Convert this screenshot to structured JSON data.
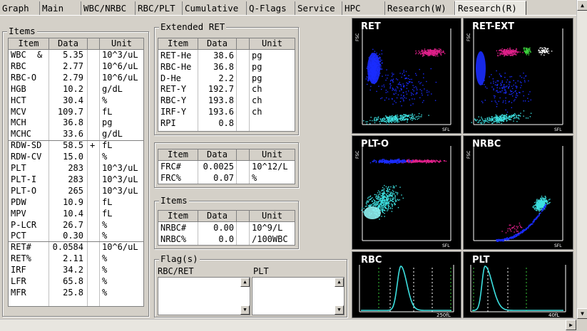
{
  "tabs": [
    "Graph",
    "Main",
    "WBC/NRBC",
    "RBC/PLT",
    "Cumulative",
    "Q-Flags",
    "Service",
    "HPC",
    "Research(W)",
    "Research(R)"
  ],
  "active_tab": "Research(R)",
  "items": {
    "title": "Items",
    "headers": [
      "Item",
      "Data",
      "Unit"
    ],
    "rows": [
      [
        "WBC",
        "&",
        "5.35",
        "",
        "10^3/uL"
      ],
      [
        "RBC",
        "",
        "2.77",
        "",
        "10^6/uL"
      ],
      [
        "RBC-O",
        "",
        "2.79",
        "",
        "10^6/uL"
      ],
      [
        "HGB",
        "",
        "10.2",
        "",
        "g/dL"
      ],
      [
        "HCT",
        "",
        "30.4",
        "",
        "%"
      ],
      [
        "MCV",
        "",
        "109.7",
        "",
        "fL"
      ],
      [
        "MCH",
        "",
        "36.8",
        "",
        "pg"
      ],
      [
        "MCHC",
        "",
        "33.6",
        "",
        "g/dL"
      ],
      [
        "RDW-SD",
        "",
        "58.5",
        "+",
        "fL"
      ],
      [
        "RDW-CV",
        "",
        "15.0",
        "",
        "%"
      ],
      [
        "PLT",
        "",
        "283",
        "",
        "10^3/uL"
      ],
      [
        "PLT-I",
        "",
        "283",
        "",
        "10^3/uL"
      ],
      [
        "PLT-O",
        "",
        "265",
        "",
        "10^3/uL"
      ],
      [
        "PDW",
        "",
        "10.9",
        "",
        "fL"
      ],
      [
        "MPV",
        "",
        "10.4",
        "",
        "fL"
      ],
      [
        "P-LCR",
        "",
        "26.7",
        "",
        "%"
      ],
      [
        "PCT",
        "",
        "0.30",
        "",
        "%"
      ],
      [
        "RET#",
        "",
        "0.0584",
        "",
        "10^6/uL"
      ],
      [
        "RET%",
        "",
        "2.11",
        "",
        "%"
      ],
      [
        "IRF",
        "",
        "34.2",
        "",
        "%"
      ],
      [
        "LFR",
        "",
        "65.8",
        "",
        "%"
      ],
      [
        "MFR",
        "",
        "25.8",
        "",
        "%"
      ]
    ]
  },
  "extended": {
    "title": "Extended RET",
    "headers": [
      "Item",
      "Data",
      "Unit"
    ],
    "rows": [
      [
        "RET-He",
        "38.6",
        "pg"
      ],
      [
        "RBC-He",
        "36.8",
        "pg"
      ],
      [
        "D-He",
        "2.2",
        "pg"
      ],
      [
        "RET-Y",
        "192.7",
        "ch"
      ],
      [
        "RBC-Y",
        "193.8",
        "ch"
      ],
      [
        "IRF-Y",
        "193.6",
        "ch"
      ],
      [
        "RPI",
        "0.8",
        ""
      ]
    ]
  },
  "frc": {
    "headers": [
      "Item",
      "Data",
      "Unit"
    ],
    "rows": [
      [
        "FRC#",
        "0.0025",
        "10^12/L"
      ],
      [
        "FRC%",
        "0.07",
        "%"
      ]
    ]
  },
  "nrbc_items": {
    "title": "Items",
    "headers": [
      "Item",
      "Data",
      "Unit"
    ],
    "rows": [
      [
        "NRBC#",
        "0.00",
        "10^9/L"
      ],
      [
        "NRBC%",
        "0.0",
        "/100WBC"
      ]
    ]
  },
  "flags": {
    "title": "Flag(s)",
    "rbc_ret_label": "RBC/RET",
    "plt_label": "PLT"
  },
  "plots": {
    "ret": {
      "title": "RET",
      "y": "FSC",
      "x": "SFL"
    },
    "ret_ext": {
      "title": "RET-EXT",
      "y": "FSC",
      "x": "SFL"
    },
    "plt_o": {
      "title": "PLT-O",
      "y": "FSC",
      "x": "SFL"
    },
    "nrbc": {
      "title": "NRBC",
      "y": "FSC",
      "x": "SFL"
    },
    "rbc": {
      "title": "RBC",
      "x": "250fL"
    },
    "plt": {
      "title": "PLT",
      "x": "40fL"
    }
  },
  "colors": {
    "blue": "#1a2cff",
    "magenta": "#e0208a",
    "cyan": "#3de0e0",
    "green": "#3cd23c"
  }
}
